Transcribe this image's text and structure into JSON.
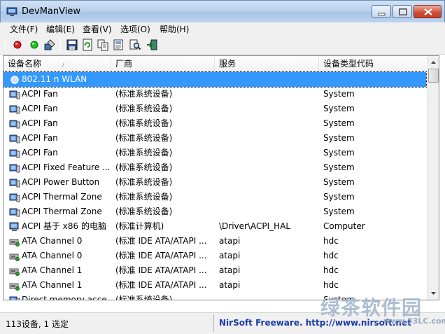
{
  "window": {
    "title": "DevManView"
  },
  "menu": [
    "文件(F)",
    "编辑(E)",
    "查看(V)",
    "选项(O)",
    "帮助(H)"
  ],
  "toolbar": {
    "buttons": [
      "enable-red-icon",
      "enable-green-icon",
      "properties-icon",
      "save-icon",
      "refresh-icon",
      "copy-icon",
      "html-report-icon",
      "find-icon",
      "exit-icon"
    ]
  },
  "table": {
    "columns": [
      "设备名称",
      "厂商",
      "服务",
      "设备类型代码"
    ],
    "rows": [
      {
        "name": "802.11 n WLAN",
        "vendor": "",
        "service": "",
        "type": "",
        "selected": true,
        "icon": "network-adapter-icon"
      },
      {
        "name": "ACPI Fan",
        "vendor": "(标准系统设备)",
        "service": "",
        "type": "System",
        "icon": "system-device-icon"
      },
      {
        "name": "ACPI Fan",
        "vendor": "(标准系统设备)",
        "service": "",
        "type": "System",
        "icon": "system-device-icon"
      },
      {
        "name": "ACPI Fan",
        "vendor": "(标准系统设备)",
        "service": "",
        "type": "System",
        "icon": "system-device-icon"
      },
      {
        "name": "ACPI Fan",
        "vendor": "(标准系统设备)",
        "service": "",
        "type": "System",
        "icon": "system-device-icon"
      },
      {
        "name": "ACPI Fan",
        "vendor": "(标准系统设备)",
        "service": "",
        "type": "System",
        "icon": "system-device-icon"
      },
      {
        "name": "ACPI Fixed Feature ...",
        "vendor": "(标准系统设备)",
        "service": "",
        "type": "System",
        "icon": "system-device-icon"
      },
      {
        "name": "ACPI Power Button",
        "vendor": "(标准系统设备)",
        "service": "",
        "type": "System",
        "icon": "system-device-icon"
      },
      {
        "name": "ACPI Thermal Zone",
        "vendor": "(标准系统设备)",
        "service": "",
        "type": "System",
        "icon": "system-device-icon"
      },
      {
        "name": "ACPI Thermal Zone",
        "vendor": "(标准系统设备)",
        "service": "",
        "type": "System",
        "icon": "system-device-icon"
      },
      {
        "name": "ACPI 基于 x86 的电脑",
        "vendor": "(标准计算机)",
        "service": "\\Driver\\ACPI_HAL",
        "type": "Computer",
        "icon": "computer-icon"
      },
      {
        "name": "ATA Channel 0",
        "vendor": "(标准 IDE ATA/ATAPI ...",
        "service": "atapi",
        "type": "hdc",
        "icon": "ide-controller-icon"
      },
      {
        "name": "ATA Channel 0",
        "vendor": "(标准 IDE ATA/ATAPI ...",
        "service": "atapi",
        "type": "hdc",
        "icon": "ide-controller-icon"
      },
      {
        "name": "ATA Channel 1",
        "vendor": "(标准 IDE ATA/ATAPI ...",
        "service": "atapi",
        "type": "hdc",
        "icon": "ide-controller-icon"
      },
      {
        "name": "ATA Channel 1",
        "vendor": "(标准 IDE ATA/ATAPI ...",
        "service": "atapi",
        "type": "hdc",
        "icon": "ide-controller-icon"
      },
      {
        "name": "Direct memory acce...",
        "vendor": "(标准系统设备)",
        "service": "",
        "type": "System",
        "icon": "system-device-icon"
      }
    ]
  },
  "status": {
    "count": "113设备, 1 选定",
    "credit": "NirSoft Freeware.  http://www.nirsoft.net"
  },
  "watermark": {
    "text": "绿茶软件园",
    "url": "www.33LC.com"
  },
  "colors": {
    "selection": "#3399ff",
    "link": "#1a3aa8"
  }
}
